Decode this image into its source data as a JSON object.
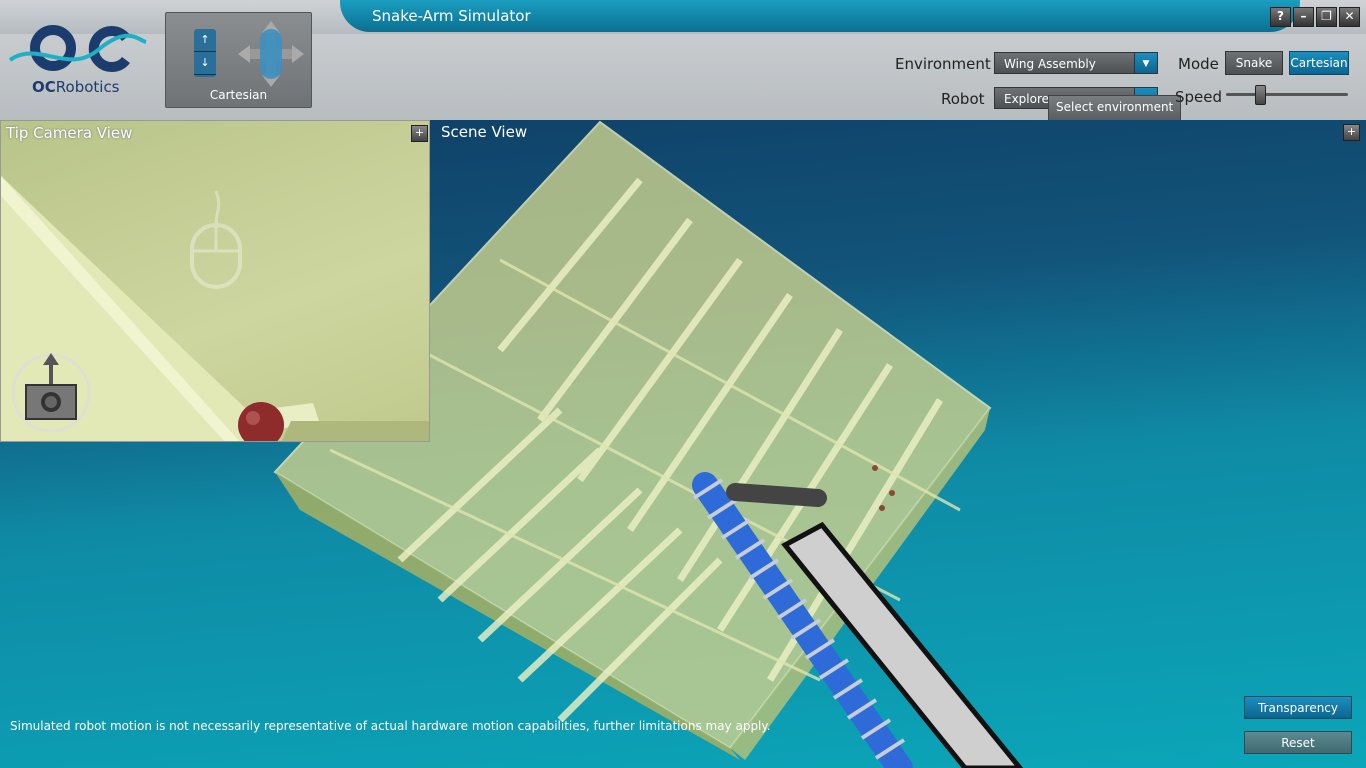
{
  "window": {
    "title": "Snake-Arm Simulator",
    "buttons": [
      "?",
      "–",
      "❐",
      "✕"
    ]
  },
  "brand": {
    "logo_mark": "OC",
    "name_bold": "OC",
    "name_rest": "Robotics"
  },
  "nav_widget": {
    "label": "Cartesian",
    "up": "↑",
    "down": "↓"
  },
  "controls": {
    "environment_label": "Environment",
    "environment_value": "Wing Assembly",
    "robot_label": "Robot",
    "robot_value": "Explorer",
    "tooltip": "Select environment",
    "mode_label": "Mode",
    "mode_snake": "Snake",
    "mode_cartesian": "Cartesian",
    "mode_selected": "Cartesian",
    "speed_label": "Speed",
    "speed_level": 0.28
  },
  "camera_panel": {
    "title": "Tip Camera View",
    "expand": "+"
  },
  "scene_panel": {
    "title": "Scene View",
    "expand": "+"
  },
  "disclaimer": "Simulated robot motion is not necessarily representative of actual hardware motion capabilities, further limitations may apply.",
  "buttons": {
    "transparency": "Transparency",
    "reset": "Reset"
  },
  "colors": {
    "accent": "#1a8fc0",
    "wing": "#c9d08e",
    "robot_arm": "#2f6bd8",
    "sky_top": "#0f3f66",
    "sky_bottom": "#0ba6b9"
  }
}
